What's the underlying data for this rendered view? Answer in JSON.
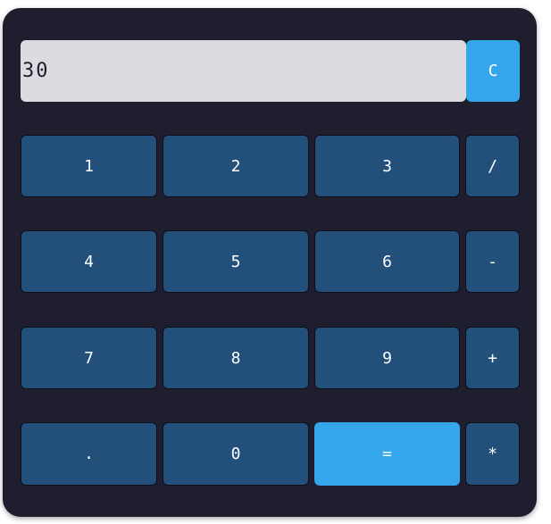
{
  "display": {
    "value": "30"
  },
  "buttons": {
    "clear": "C",
    "one": "1",
    "two": "2",
    "three": "3",
    "divide": "/",
    "four": "4",
    "five": "5",
    "six": "6",
    "minus": "-",
    "seven": "7",
    "eight": "8",
    "nine": "9",
    "plus": "+",
    "dot": ".",
    "zero": "0",
    "equals": "=",
    "multiply": "*"
  },
  "colors": {
    "body": "#1e1e2f",
    "display": "#dcdbe0",
    "key": "#22507a",
    "accent": "#35a6ec"
  }
}
